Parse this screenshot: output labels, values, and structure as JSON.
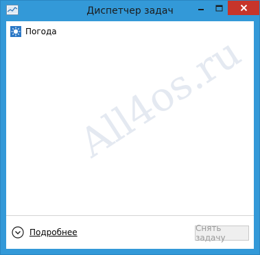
{
  "window": {
    "title": "Диспетчер задач",
    "accent_color": "#3399d8",
    "close_color": "#c7352a"
  },
  "titlebar": {
    "app_icon": "task-manager-icon",
    "minimize_icon": "minimize-icon",
    "maximize_icon": "maximize-icon",
    "close_icon": "close-icon"
  },
  "processes": [
    {
      "name": "Погода",
      "icon": "weather-app-icon"
    }
  ],
  "watermark": "All4os.ru",
  "footer": {
    "more_details_label": "Подробнее",
    "more_details_icon": "chevron-down-circle-icon",
    "end_task_label": "Снять задачу"
  }
}
